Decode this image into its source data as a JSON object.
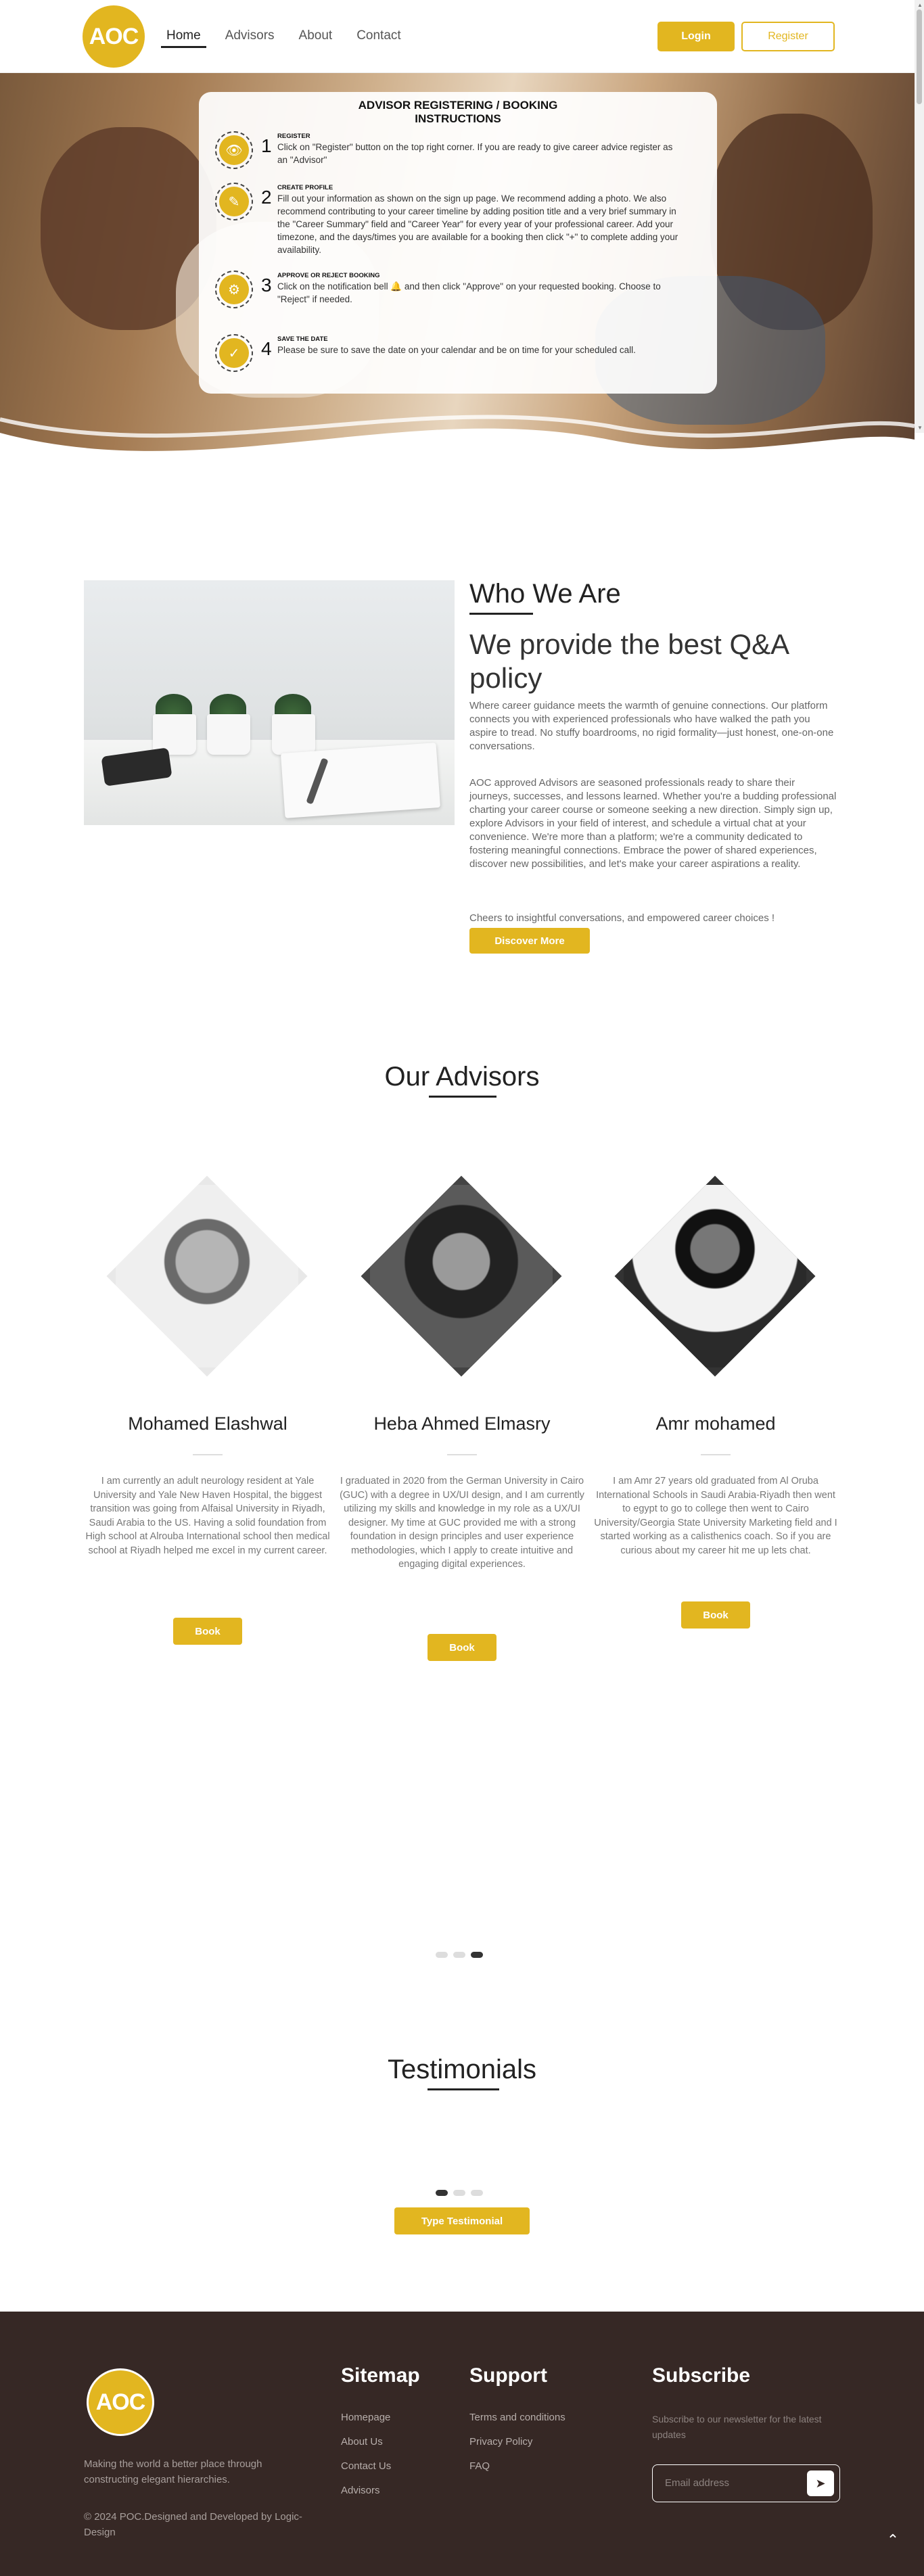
{
  "header": {
    "logo": "AOC",
    "nav": [
      "Home",
      "Advisors",
      "About",
      "Contact"
    ],
    "login": "Login",
    "register": "Register"
  },
  "instructions": {
    "title": "ADVISOR REGISTERING / BOOKING INSTRUCTIONS",
    "steps": [
      {
        "num": "1",
        "head": "REGISTER",
        "text": "Click on \"Register\" button on the top right corner. If you are ready to give career advice register as an \"Advisor\"",
        "icon": "eye-icon"
      },
      {
        "num": "2",
        "head": "CREATE PROFILE",
        "text": "Fill out your information as shown on the sign up page. We recommend adding a photo. We also recommend contributing to your career timeline by adding position title and a very brief summary in the \"Career Summary\" field and \"Career Year\" for every year of your professional career. Add your timezone, and the days/times you are available for a booking then click \"+\" to complete adding your availability.",
        "icon": "pencil-icon"
      },
      {
        "num": "3",
        "head": "APPROVE OR REJECT BOOKING",
        "text": "Click on the notification bell 🔔 and then click \"Approve\" on your requested booking. Choose to \"Reject\" if needed.",
        "icon": "gear-icon"
      },
      {
        "num": "4",
        "head": "SAVE THE DATE",
        "text": "Please be sure to save the date on your calendar and be on time for your scheduled call.",
        "icon": "check-icon"
      }
    ]
  },
  "who": {
    "title": "Who We Are",
    "subtitle": "We provide the best Q&A policy",
    "p1": "Where career guidance meets the warmth of genuine connections. Our platform connects you with experienced professionals who have walked the path you aspire to tread. No stuffy boardrooms, no rigid formality—just honest, one-on-one conversations.",
    "p2": "AOC approved Advisors are seasoned professionals ready to share their journeys, successes, and lessons learned. Whether you're a budding professional charting your career course or someone seeking a new direction. Simply sign up, explore Advisors in your field of interest, and schedule a virtual chat at your convenience. We're more than a platform; we're a community dedicated to fostering meaningful connections. Embrace the power of shared experiences, discover new possibilities, and let's make your career aspirations a reality.",
    "p3": "Cheers to insightful conversations, and empowered career choices !",
    "button": "Discover More"
  },
  "advisors": {
    "title": "Our Advisors",
    "book_label": "Book",
    "items": [
      {
        "name": "Mohamed Elashwal",
        "desc": "I am currently an adult neurology resident at Yale University and Yale New Haven Hospital, the biggest transition was going from Alfaisal University in Riyadh, Saudi Arabia to the US. Having a solid foundation from High school at Alrouba International school then medical school at Riyadh helped me excel in my current career."
      },
      {
        "name": "Heba Ahmed Elmasry",
        "desc": "I graduated in 2020 from the German University in Cairo (GUC) with a degree in UX/UI design, and I am currently utilizing my skills and knowledge in my role as a UX/UI designer. My time at GUC provided me with a strong foundation in design principles and user experience methodologies, which I apply to create intuitive and engaging digital experiences."
      },
      {
        "name": "Amr mohamed",
        "desc": "I am Amr 27 years old graduated from Al Oruba International Schools in Saudi Arabia-Riyadh then went to egypt to go to college then went to Cairo University/Georgia State University Marketing field and I started working as a calisthenics coach. So if you are curious about my career hit me up lets chat."
      }
    ]
  },
  "testimonials": {
    "title": "Testimonials",
    "button": "Type Testimonial"
  },
  "footer": {
    "logo": "AOC",
    "tagline": "Making the world a better place through constructing elegant hierarchies.",
    "copyright": "© 2024 POC.Designed and Developed by Logic-Design",
    "sitemap_title": "Sitemap",
    "sitemap": [
      "Homepage",
      "About Us",
      "Contact Us",
      "Advisors"
    ],
    "support_title": "Support",
    "support": [
      "Terms and conditions",
      "Privacy Policy",
      "FAQ"
    ],
    "subscribe_title": "Subscribe",
    "subscribe_text": "Subscribe to our newsletter for the latest updates",
    "email_placeholder": "Email address"
  },
  "colors": {
    "accent": "#e2b620",
    "footer_bg": "#362825"
  }
}
